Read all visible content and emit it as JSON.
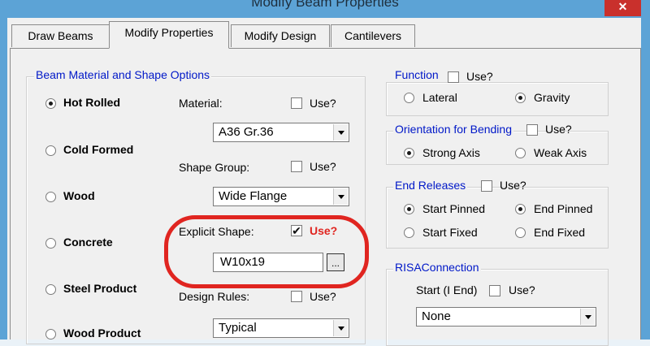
{
  "window": {
    "title": "Modify Beam Properties",
    "close_glyph": "✕"
  },
  "tabs": [
    {
      "label": "Draw Beams",
      "active": false
    },
    {
      "label": "Modify Properties",
      "active": true
    },
    {
      "label": "Modify Design",
      "active": false
    },
    {
      "label": "Cantilevers",
      "active": false
    }
  ],
  "material_group": {
    "title": "Beam Material and Shape Options",
    "material_types": [
      {
        "label": "Hot Rolled",
        "selected": true
      },
      {
        "label": "Cold Formed",
        "selected": false
      },
      {
        "label": "Wood",
        "selected": false
      },
      {
        "label": "Concrete",
        "selected": false
      },
      {
        "label": "Steel Product",
        "selected": false
      },
      {
        "label": "Wood Product",
        "selected": false
      }
    ],
    "material": {
      "label": "Material:",
      "value": "A36 Gr.36",
      "use_label": "Use?",
      "use_checked": false
    },
    "shape_group": {
      "label": "Shape Group:",
      "value": "Wide Flange",
      "use_label": "Use?",
      "use_checked": false
    },
    "explicit_shape": {
      "label": "Explicit Shape:",
      "value": "W10x19",
      "use_label": "Use?",
      "use_checked": true,
      "browse_label": "..."
    },
    "design_rules": {
      "label": "Design Rules:",
      "value": "Typical",
      "use_label": "Use?",
      "use_checked": false
    }
  },
  "function_group": {
    "title": "Function",
    "use_label": "Use?",
    "options": [
      {
        "label": "Lateral",
        "selected": false
      },
      {
        "label": "Gravity",
        "selected": true
      }
    ]
  },
  "orientation_group": {
    "title": "Orientation for Bending",
    "use_label": "Use?",
    "options": [
      {
        "label": "Strong Axis",
        "selected": true
      },
      {
        "label": "Weak Axis",
        "selected": false
      }
    ]
  },
  "end_releases_group": {
    "title": "End Releases",
    "use_label": "Use?",
    "start_options": [
      {
        "label": "Start Pinned",
        "selected": true
      },
      {
        "label": "Start Fixed",
        "selected": false
      }
    ],
    "end_options": [
      {
        "label": "End Pinned",
        "selected": true
      },
      {
        "label": "End Fixed",
        "selected": false
      }
    ]
  },
  "risa_connection_group": {
    "title": "RISAConnection",
    "start_label": "Start (I End)",
    "use_label": "Use?",
    "value": "None"
  },
  "colors": {
    "title_bar": "#5ca3d6",
    "close_button": "#c9302c",
    "group_title": "#0018c8",
    "highlight_ring": "#e02520",
    "use_highlight": "#e02520"
  }
}
